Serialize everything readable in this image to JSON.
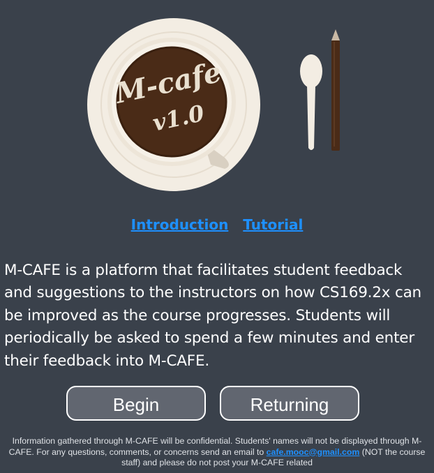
{
  "logo": {
    "title_line1": "M-cafe",
    "title_line2": "v1.0"
  },
  "nav": {
    "introduction": "Introduction",
    "tutorial": "Tutorial"
  },
  "intro_text": "M-CAFE is a platform that facilitates student feedback and suggestions to the instructors on how CS169.2x can be improved as the course progresses. Students will periodically be asked to spend a few minutes and enter their feedback into M-CAFE.",
  "buttons": {
    "begin": "Begin",
    "returning": "Returning"
  },
  "disclaimer": {
    "part1": "Information gathered through M-CAFE will be confidential. Students' names will not be displayed through M-CAFE. For any questions, comments, or concerns send an email to",
    "email": "cafe.mooc@gmail.com",
    "part2": "(NOT the course staff) and please do not post your M-CAFE related"
  },
  "colors": {
    "background": "#3a414b",
    "link": "#1e90ff",
    "button_fill": "#616670",
    "coffee": "#4a2b17",
    "cup": "#f4efe6"
  }
}
